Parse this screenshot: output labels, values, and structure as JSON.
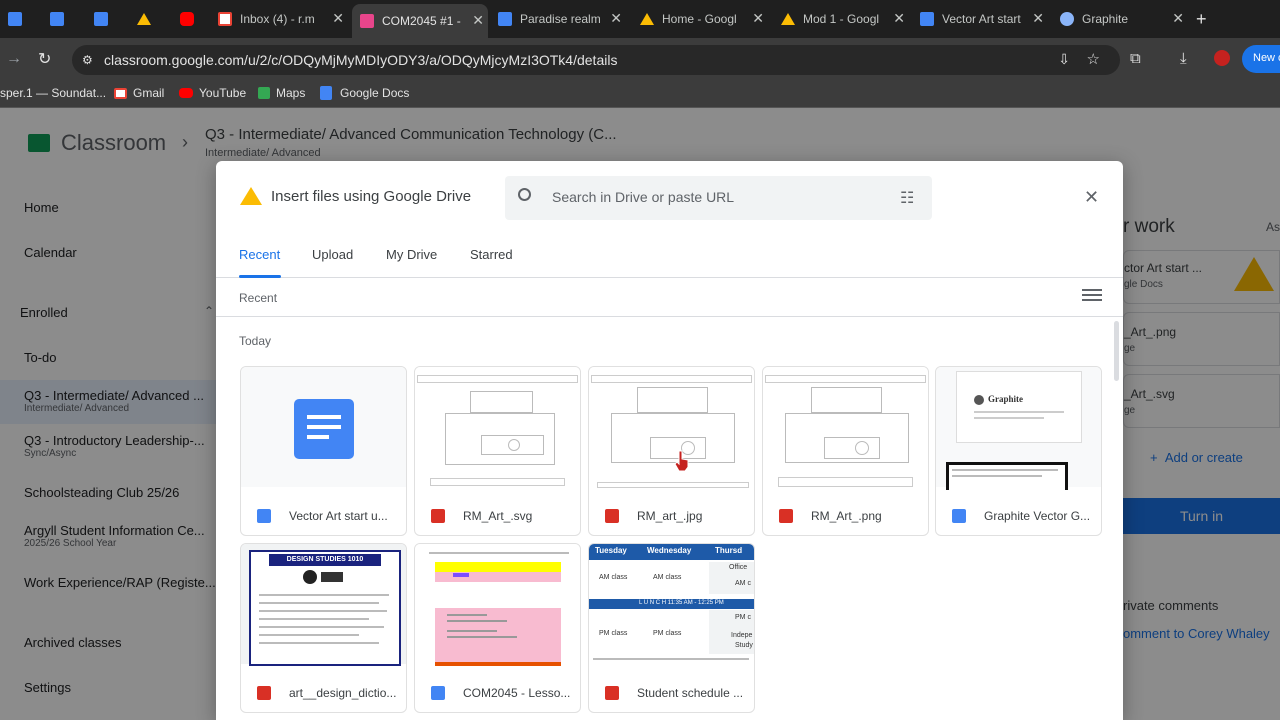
{
  "browser": {
    "tabs": [
      {
        "title": "",
        "icon": "google-docs-icon"
      },
      {
        "title": "",
        "icon": "google-docs-icon"
      },
      {
        "title": "",
        "icon": "google-docs-icon"
      },
      {
        "title": "",
        "icon": "google-drive-icon"
      },
      {
        "title": "",
        "icon": "youtube-icon"
      },
      {
        "title": "Inbox (4) - r.m",
        "icon": "gmail-icon"
      },
      {
        "title": "COM2045 #1 -",
        "icon": "classroom-icon"
      },
      {
        "title": "Paradise realm",
        "icon": "google-docs-icon"
      },
      {
        "title": "Home - Googl",
        "icon": "google-drive-icon"
      },
      {
        "title": "Mod 1 - Googl",
        "icon": "google-drive-icon"
      },
      {
        "title": "Vector Art start",
        "icon": "google-docs-icon"
      },
      {
        "title": "Graphite",
        "icon": "graphite-icon"
      }
    ],
    "url": "classroom.google.com/u/2/c/ODQyMjMyMDIyODY3/a/ODQyMjcyMzI3OTk4/details",
    "profile_button": "New c",
    "bookmarks": [
      {
        "label": "sper.1 — Soundat...",
        "icon": "soundcloud-icon"
      },
      {
        "label": "Gmail",
        "icon": "gmail-icon"
      },
      {
        "label": "YouTube",
        "icon": "youtube-icon"
      },
      {
        "label": "Maps",
        "icon": "maps-icon"
      },
      {
        "label": "Google Docs",
        "icon": "google-docs-icon"
      }
    ]
  },
  "classroom": {
    "app_name": "Classroom",
    "class_title": "Q3 - Intermediate/ Advanced Communication Technology (C...",
    "class_subtitle": "Intermediate/ Advanced",
    "sidebar": {
      "home": "Home",
      "calendar": "Calendar",
      "enrolled": "Enrolled",
      "todo": "To-do",
      "classes": [
        {
          "name": "Q3 - Intermediate/ Advanced ...",
          "sub": "Intermediate/ Advanced"
        },
        {
          "name": "Q3 - Introductory Leadership-...",
          "sub": "Sync/Async"
        },
        {
          "name": "Schoolsteading Club 25/26",
          "sub": ""
        },
        {
          "name": "Argyll Student Information Ce...",
          "sub": "2025/26 School Year"
        },
        {
          "name": "Work Experience/RAP (Registe...",
          "sub": ""
        }
      ],
      "archived": "Archived classes",
      "settings": "Settings"
    },
    "right_panel": {
      "your_work": "r work",
      "assigned": "As",
      "attachments": [
        {
          "name": "ctor Art start ...",
          "type": "gle Docs"
        },
        {
          "name": "_Art_.png",
          "type": "ge"
        },
        {
          "name": "_Art_.svg",
          "type": "ge"
        }
      ],
      "add_or_create": "Add or create",
      "turn_in": "Turn in",
      "private_comments": "rivate comments",
      "add_comment": "omment to Corey Whaley"
    }
  },
  "dialog": {
    "title": "Insert files using Google Drive",
    "search_placeholder": "Search in Drive or paste URL",
    "tabs": [
      "Recent",
      "Upload",
      "My Drive",
      "Starred"
    ],
    "active_tab": "Recent",
    "section_label": "Recent",
    "group_label": "Today",
    "files": [
      {
        "name": "Vector Art start u...",
        "type": "doc"
      },
      {
        "name": "RM_Art_.svg",
        "type": "image"
      },
      {
        "name": "RM_art_.jpg",
        "type": "image"
      },
      {
        "name": "RM_Art_.png",
        "type": "image"
      },
      {
        "name": "Graphite Vector G...",
        "type": "doc"
      },
      {
        "name": "art__design_dictio...",
        "type": "pdf"
      },
      {
        "name": "COM2045 - Lesso...",
        "type": "doc"
      },
      {
        "name": "Student schedule ...",
        "type": "image"
      }
    ],
    "thumb_text": {
      "graphite_logo": "Graphite",
      "design_studies": "DESIGN STUDIES 1010",
      "schedule_days": [
        "Tuesday",
        "Wednesday",
        "Thursd"
      ],
      "schedule_cells": [
        "AM class",
        "AM class",
        "Office",
        "AM c",
        "PM class",
        "PM class",
        "PM c",
        "Indepe",
        "Study"
      ],
      "lunch": "L U N C H   11:35 AM - 12:25 PM"
    }
  },
  "colors": {
    "accent_blue": "#1a73e8",
    "turn_in_bg": "#1a73e8",
    "overlay": "rgba(0,0,0,0.45)"
  }
}
